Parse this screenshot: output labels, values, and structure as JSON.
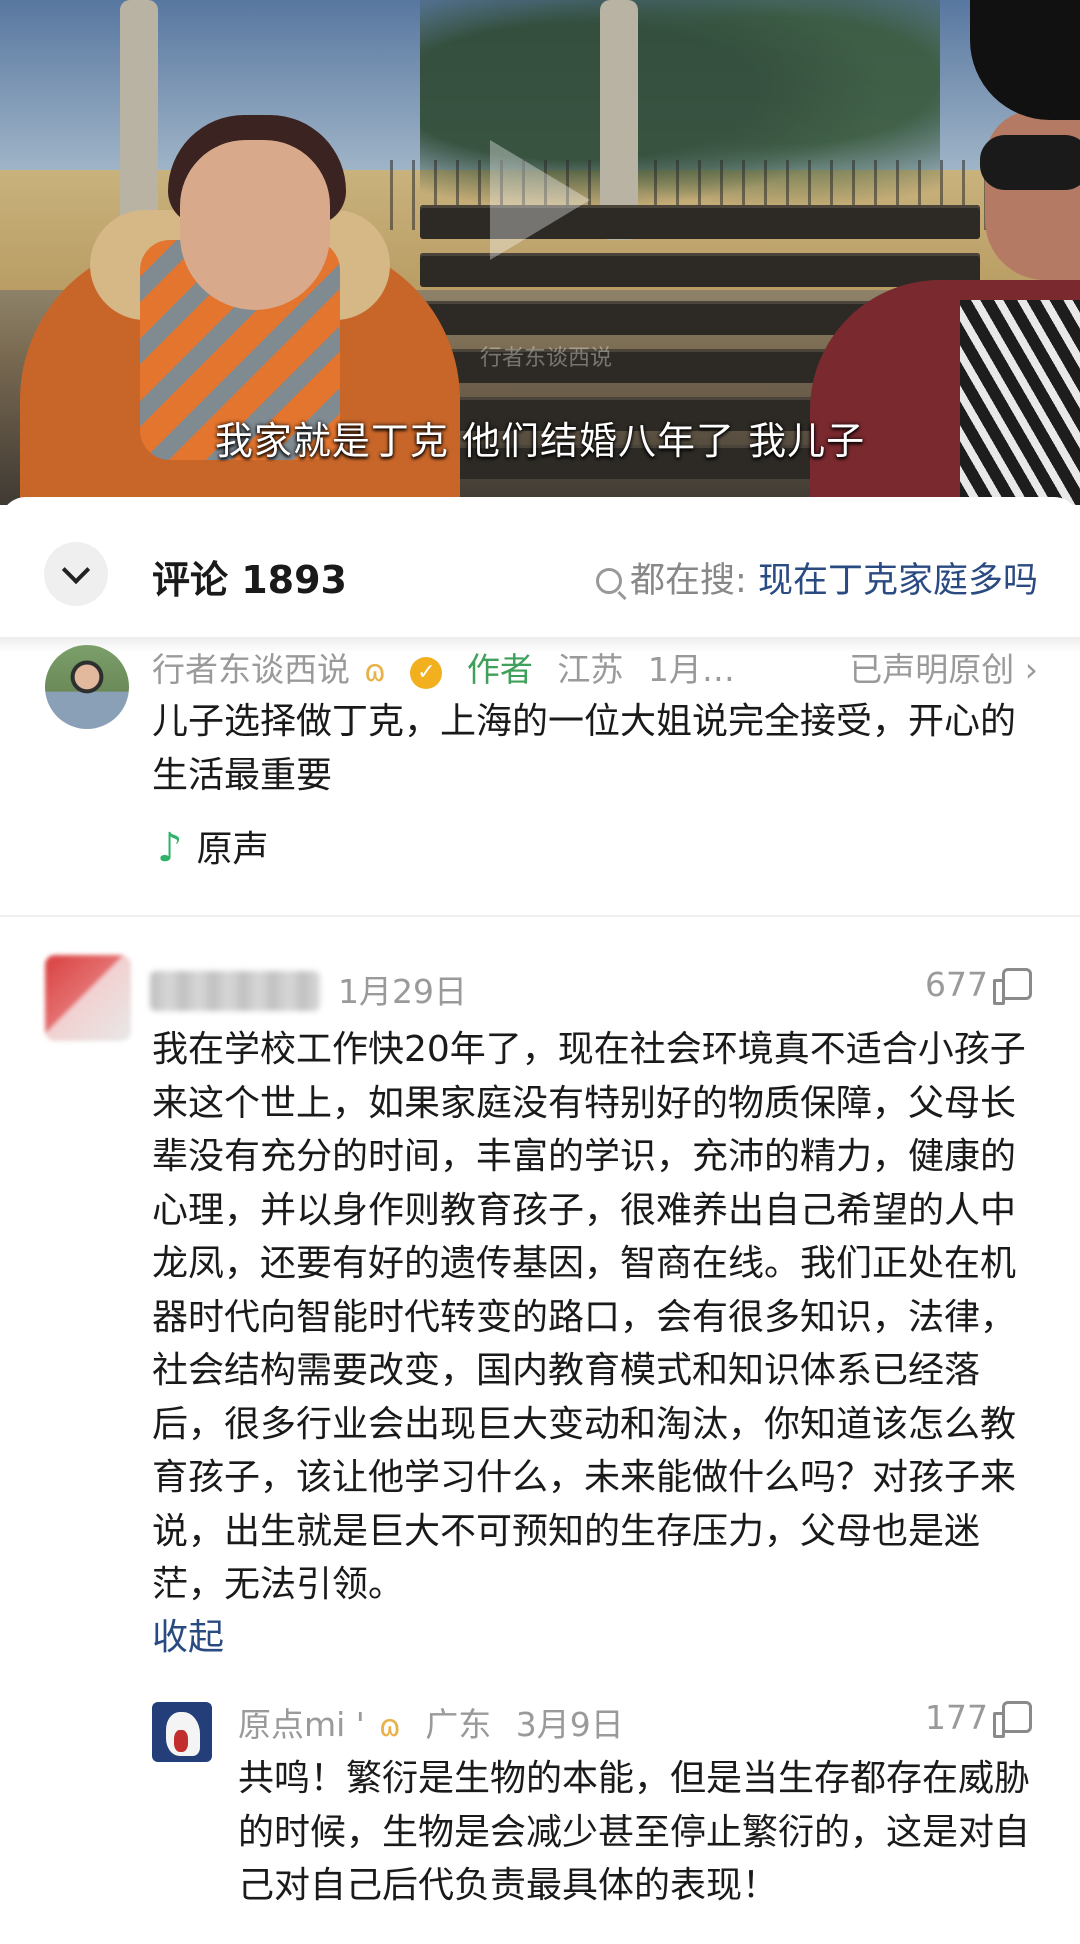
{
  "video": {
    "subtitle": "我家就是丁克 他们结婚八年了 我儿子",
    "watermark": "行者东谈西说"
  },
  "comments_panel": {
    "count_label": "评论 1893",
    "search_hint_prefix": "都在搜:",
    "search_hint_keyword": "现在丁克家庭多吗"
  },
  "author_post": {
    "name": "行者东谈西说",
    "author_tag": "作者",
    "location": "江苏",
    "date": "1月…",
    "original_claim": "已声明原创",
    "text": "儿子选择做丁克，上海的一位大姐说完全接受，开心的生活最重要",
    "audio_label": "原声"
  },
  "comment1": {
    "date": "1月29日",
    "likes": "677",
    "text": "我在学校工作快20年了，现在社会环境真不适合小孩子来这个世上，如果家庭没有特别好的物质保障，父母长辈没有充分的时间，丰富的学识，充沛的精力，健康的心理，并以身作则教育孩子，很难养出自己希望的人中龙凤，还要有好的遗传基因，智商在线。我们正处在机器时代向智能时代转变的路口，会有很多知识，法律，社会结构需要改变，国内教育模式和知识体系已经落后，很多行业会出现巨大变动和淘汰，你知道该怎么教育孩子，该让他学习什么，未来能做什么吗？对孩子来说，出生就是巨大不可预知的生存压力，父母也是迷茫，无法引领。",
    "collapse_label": "收起"
  },
  "reply1": {
    "name": "原点mi '",
    "location": "广东",
    "date": "3月9日",
    "likes": "177",
    "text": "共鸣！繁衍是生物的本能，但是当生存都存在威胁的时候，生物是会减少甚至停止繁衍的，这是对自己对自己后代负责最具体的表现！"
  },
  "colors": {
    "link": "#2a4a82",
    "author_tag": "#3ea05a",
    "audio_note": "#2fb36b",
    "meta_gray": "#9a9a9a"
  },
  "icons": [
    "play-icon",
    "chevron-down-icon",
    "search-icon",
    "butterfly-icon",
    "verified-icon",
    "chevron-right-icon",
    "music-note-icon",
    "thumbs-up-icon"
  ]
}
